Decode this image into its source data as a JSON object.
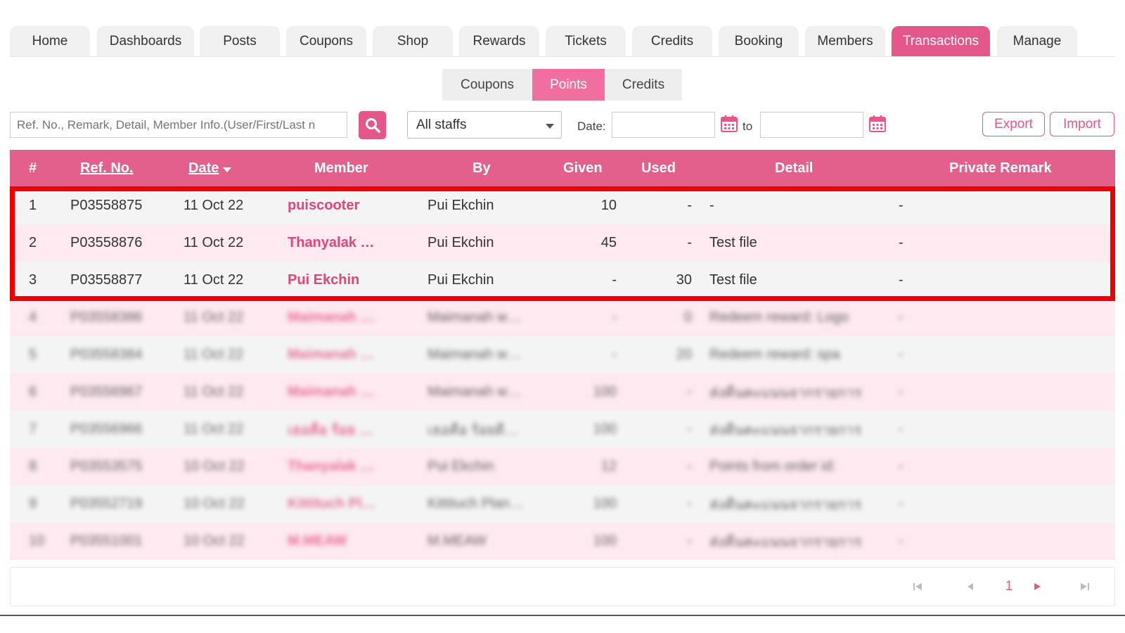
{
  "nav": {
    "tabs": [
      {
        "label": "Home"
      },
      {
        "label": "Dashboards"
      },
      {
        "label": "Posts"
      },
      {
        "label": "Coupons"
      },
      {
        "label": "Shop"
      },
      {
        "label": "Rewards"
      },
      {
        "label": "Tickets"
      },
      {
        "label": "Credits"
      },
      {
        "label": "Booking"
      },
      {
        "label": "Members"
      },
      {
        "label": "Transactions",
        "active": true
      },
      {
        "label": "Manage"
      }
    ]
  },
  "subtabs": [
    {
      "label": "Coupons"
    },
    {
      "label": "Points",
      "active": true
    },
    {
      "label": "Credits"
    }
  ],
  "toolbar": {
    "search_placeholder": "Ref. No., Remark, Detail, Member Info.(User/First/Last n",
    "staff_select": "All staffs",
    "date_label": "Date:",
    "to_label": "to",
    "export_label": "Export",
    "import_label": "Import"
  },
  "table": {
    "headers": {
      "num": "#",
      "ref": "Ref. No.",
      "date": "Date",
      "member": "Member",
      "by": "By",
      "given": "Given",
      "used": "Used",
      "detail": "Detail",
      "remark": "Private Remark"
    },
    "rows": [
      {
        "num": "1",
        "ref": "P03558875",
        "date": "11 Oct 22",
        "member": "puiscooter",
        "by": "Pui Ekchin",
        "given": "10",
        "used": "-",
        "detail": "-",
        "remark": "-"
      },
      {
        "num": "2",
        "ref": "P03558876",
        "date": "11 Oct 22",
        "member": "Thanyalak …",
        "by": "Pui Ekchin",
        "given": "45",
        "used": "-",
        "detail": "Test file",
        "remark": "-"
      },
      {
        "num": "3",
        "ref": "P03558877",
        "date": "11 Oct 22",
        "member": "Pui Ekchin",
        "by": "Pui Ekchin",
        "given": "-",
        "used": "30",
        "detail": "Test file",
        "remark": "-"
      },
      {
        "num": "4",
        "ref": "P03558386",
        "date": "11 Oct 22",
        "member": "Maimanah …",
        "by": "Maimanah w…",
        "given": "-",
        "used": "0",
        "detail": "Redeem reward: Logo",
        "remark": "-"
      },
      {
        "num": "5",
        "ref": "P03558384",
        "date": "11 Oct 22",
        "member": "Maimanah …",
        "by": "Maimanah w…",
        "given": "-",
        "used": "20",
        "detail": "Redeem reward: spa",
        "remark": "-"
      },
      {
        "num": "6",
        "ref": "P03556967",
        "date": "11 Oct 22",
        "member": "Maimanah …",
        "by": "Maimanah w…",
        "given": "100",
        "used": "-",
        "detail": "ส่งคืนคะแนนจากรายการ",
        "remark": "-"
      },
      {
        "num": "7",
        "ref": "P03556966",
        "date": "11 Oct 22",
        "member": "เธอคือ ร้อย …",
        "by": "เธอคือ ร้อยดี…",
        "given": "100",
        "used": "-",
        "detail": "ส่งคืนคะแนนจากรายการ",
        "remark": "-"
      },
      {
        "num": "8",
        "ref": "P03553575",
        "date": "10 Oct 22",
        "member": "Thanyalak …",
        "by": "Pui Ekchin",
        "given": "12",
        "used": "-",
        "detail": "Points from order id:",
        "remark": "-"
      },
      {
        "num": "9",
        "ref": "P03552719",
        "date": "10 Oct 22",
        "member": "Kittituch Pl…",
        "by": "Kittituch Plan…",
        "given": "100",
        "used": "-",
        "detail": "ส่งคืนคะแนนจากรายการ",
        "remark": "-"
      },
      {
        "num": "10",
        "ref": "P03551001",
        "date": "10 Oct 22",
        "member": "M.MEAW",
        "by": "M.MEAW",
        "given": "100",
        "used": "-",
        "detail": "ส่งคืนคะแนนจากรายการ",
        "remark": "-"
      }
    ]
  },
  "pager": {
    "current": "1"
  },
  "colors": {
    "accent": "#e4578a",
    "header": "#e4608c",
    "highlight": "#ee0000"
  }
}
